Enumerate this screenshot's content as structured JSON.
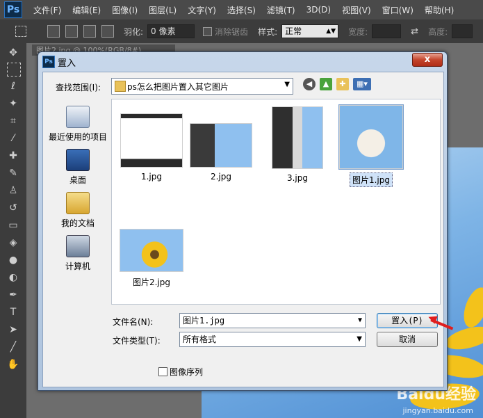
{
  "app": {
    "logo": "Ps",
    "menu": [
      "文件(F)",
      "编辑(E)",
      "图像(I)",
      "图层(L)",
      "文字(Y)",
      "选择(S)",
      "滤镜(T)",
      "3D(D)",
      "视图(V)",
      "窗口(W)",
      "帮助(H)"
    ]
  },
  "options": {
    "feather_label": "羽化:",
    "feather_value": "0 像素",
    "antialias_label": "消除锯齿",
    "style_label": "样式:",
    "style_value": "正常",
    "width_label": "宽度:",
    "height_label": "高度:"
  },
  "document": {
    "tab": "图片2.jpg @ 100%(RGB/8#)"
  },
  "dialog": {
    "icon": "Ps",
    "title": "置入",
    "close": "x",
    "lookin_label": "查找范围(I):",
    "lookin_value": "ps怎么把图片置入其它图片",
    "places": [
      "最近使用的项目",
      "桌面",
      "我的文档",
      "计算机"
    ],
    "files": [
      {
        "name": "1.jpg",
        "selected": false
      },
      {
        "name": "2.jpg",
        "selected": false
      },
      {
        "name": "3.jpg",
        "selected": false
      },
      {
        "name": "图片1.jpg",
        "selected": true
      },
      {
        "name": "图片2.jpg",
        "selected": false
      }
    ],
    "filename_label": "文件名(N):",
    "filename_value": "图片1.jpg",
    "filetype_label": "文件类型(T):",
    "filetype_value": "所有格式",
    "place_button": "置入(P)",
    "cancel_button": "取消",
    "sequence_label": "图像序列"
  },
  "watermark": {
    "brand": "Baidu经验",
    "url": "jingyan.baidu.com"
  },
  "colors": {
    "accent": "#3c7fb1",
    "arrow": "#e01e1e",
    "close": "#c4452c"
  }
}
